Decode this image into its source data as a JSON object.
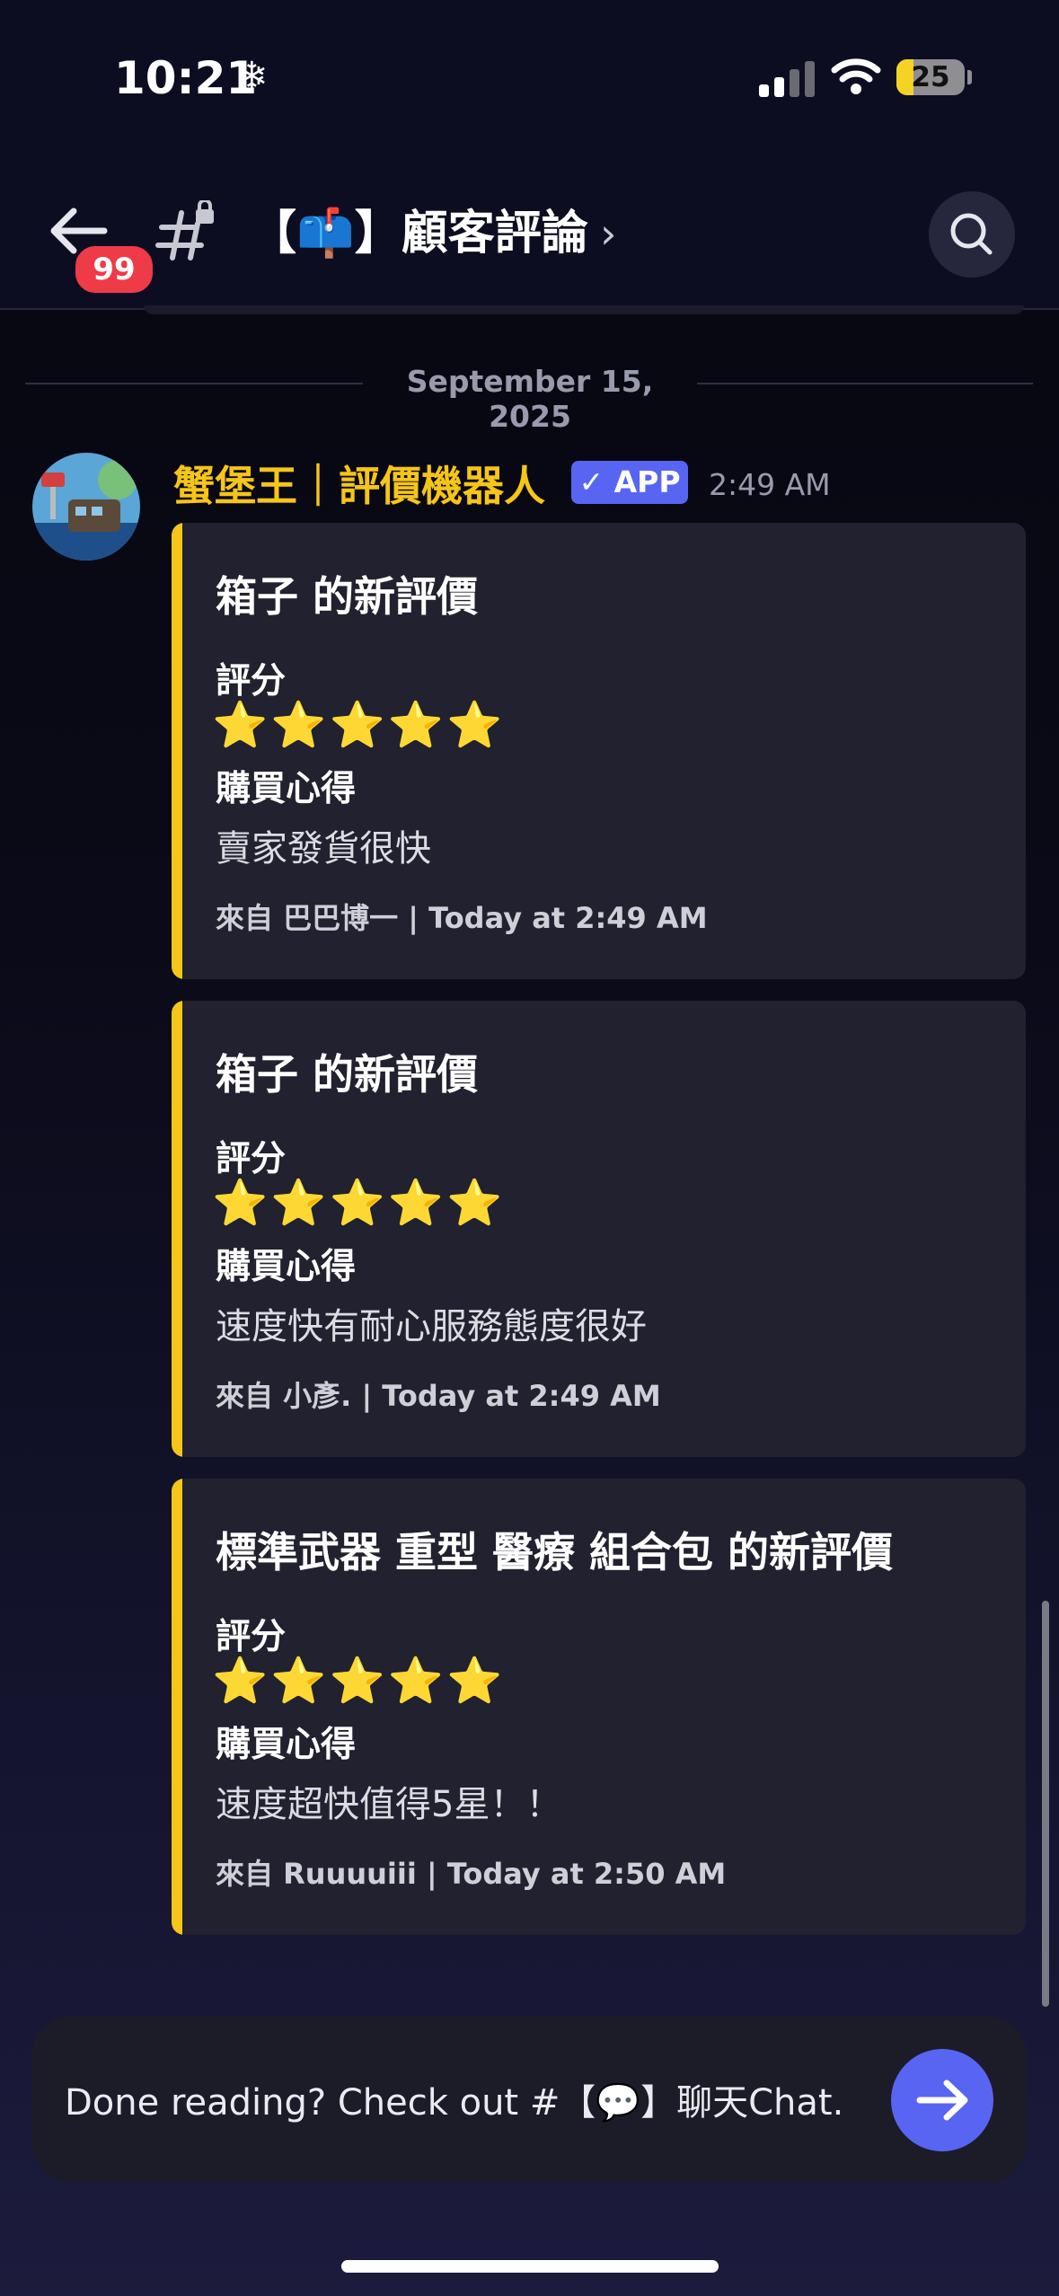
{
  "status_bar": {
    "time": "10:21",
    "weather_icon": "snowflake-icon",
    "battery_percent": "25",
    "battery_level": 0.25
  },
  "header": {
    "unread_badge": "99",
    "channel_title": "【📫】顧客評論",
    "chevron": "›"
  },
  "date_divider": "September 15, 2025",
  "message": {
    "author": "蟹堡王｜評價機器人",
    "app_badge": "✓ APP",
    "time": "2:49 AM",
    "embeds": [
      {
        "title": "箱子 的新評價",
        "rating_label": "評分",
        "stars": "⭐⭐⭐⭐⭐",
        "rating": 5,
        "review_label": "購買心得",
        "review": "賣家發貨很快",
        "footer": "來自 巴巴博一 | Today at 2:49 AM"
      },
      {
        "title": "箱子 的新評價",
        "rating_label": "評分",
        "stars": "⭐⭐⭐⭐⭐",
        "rating": 5,
        "review_label": "購買心得",
        "review": "速度快有耐心服務態度很好",
        "footer": "來自 小彥. | Today at 2:49 AM"
      },
      {
        "title": "標準武器 重型 醫療 組合包 的新評價",
        "rating_label": "評分",
        "stars": "⭐⭐⭐⭐⭐",
        "rating": 5,
        "review_label": "購買心得",
        "review": "速度超快值得5星！！",
        "footer": "來自 Ruuuuiii | Today at 2:50 AM"
      }
    ]
  },
  "bottom_prompt": {
    "text": "Done reading? Check out #【💬】聊天Chat."
  },
  "colors": {
    "accent": "#5865f2",
    "author": "#f5c518",
    "embed_bar": "#f5c518",
    "badge_red": "#ef3b48"
  }
}
